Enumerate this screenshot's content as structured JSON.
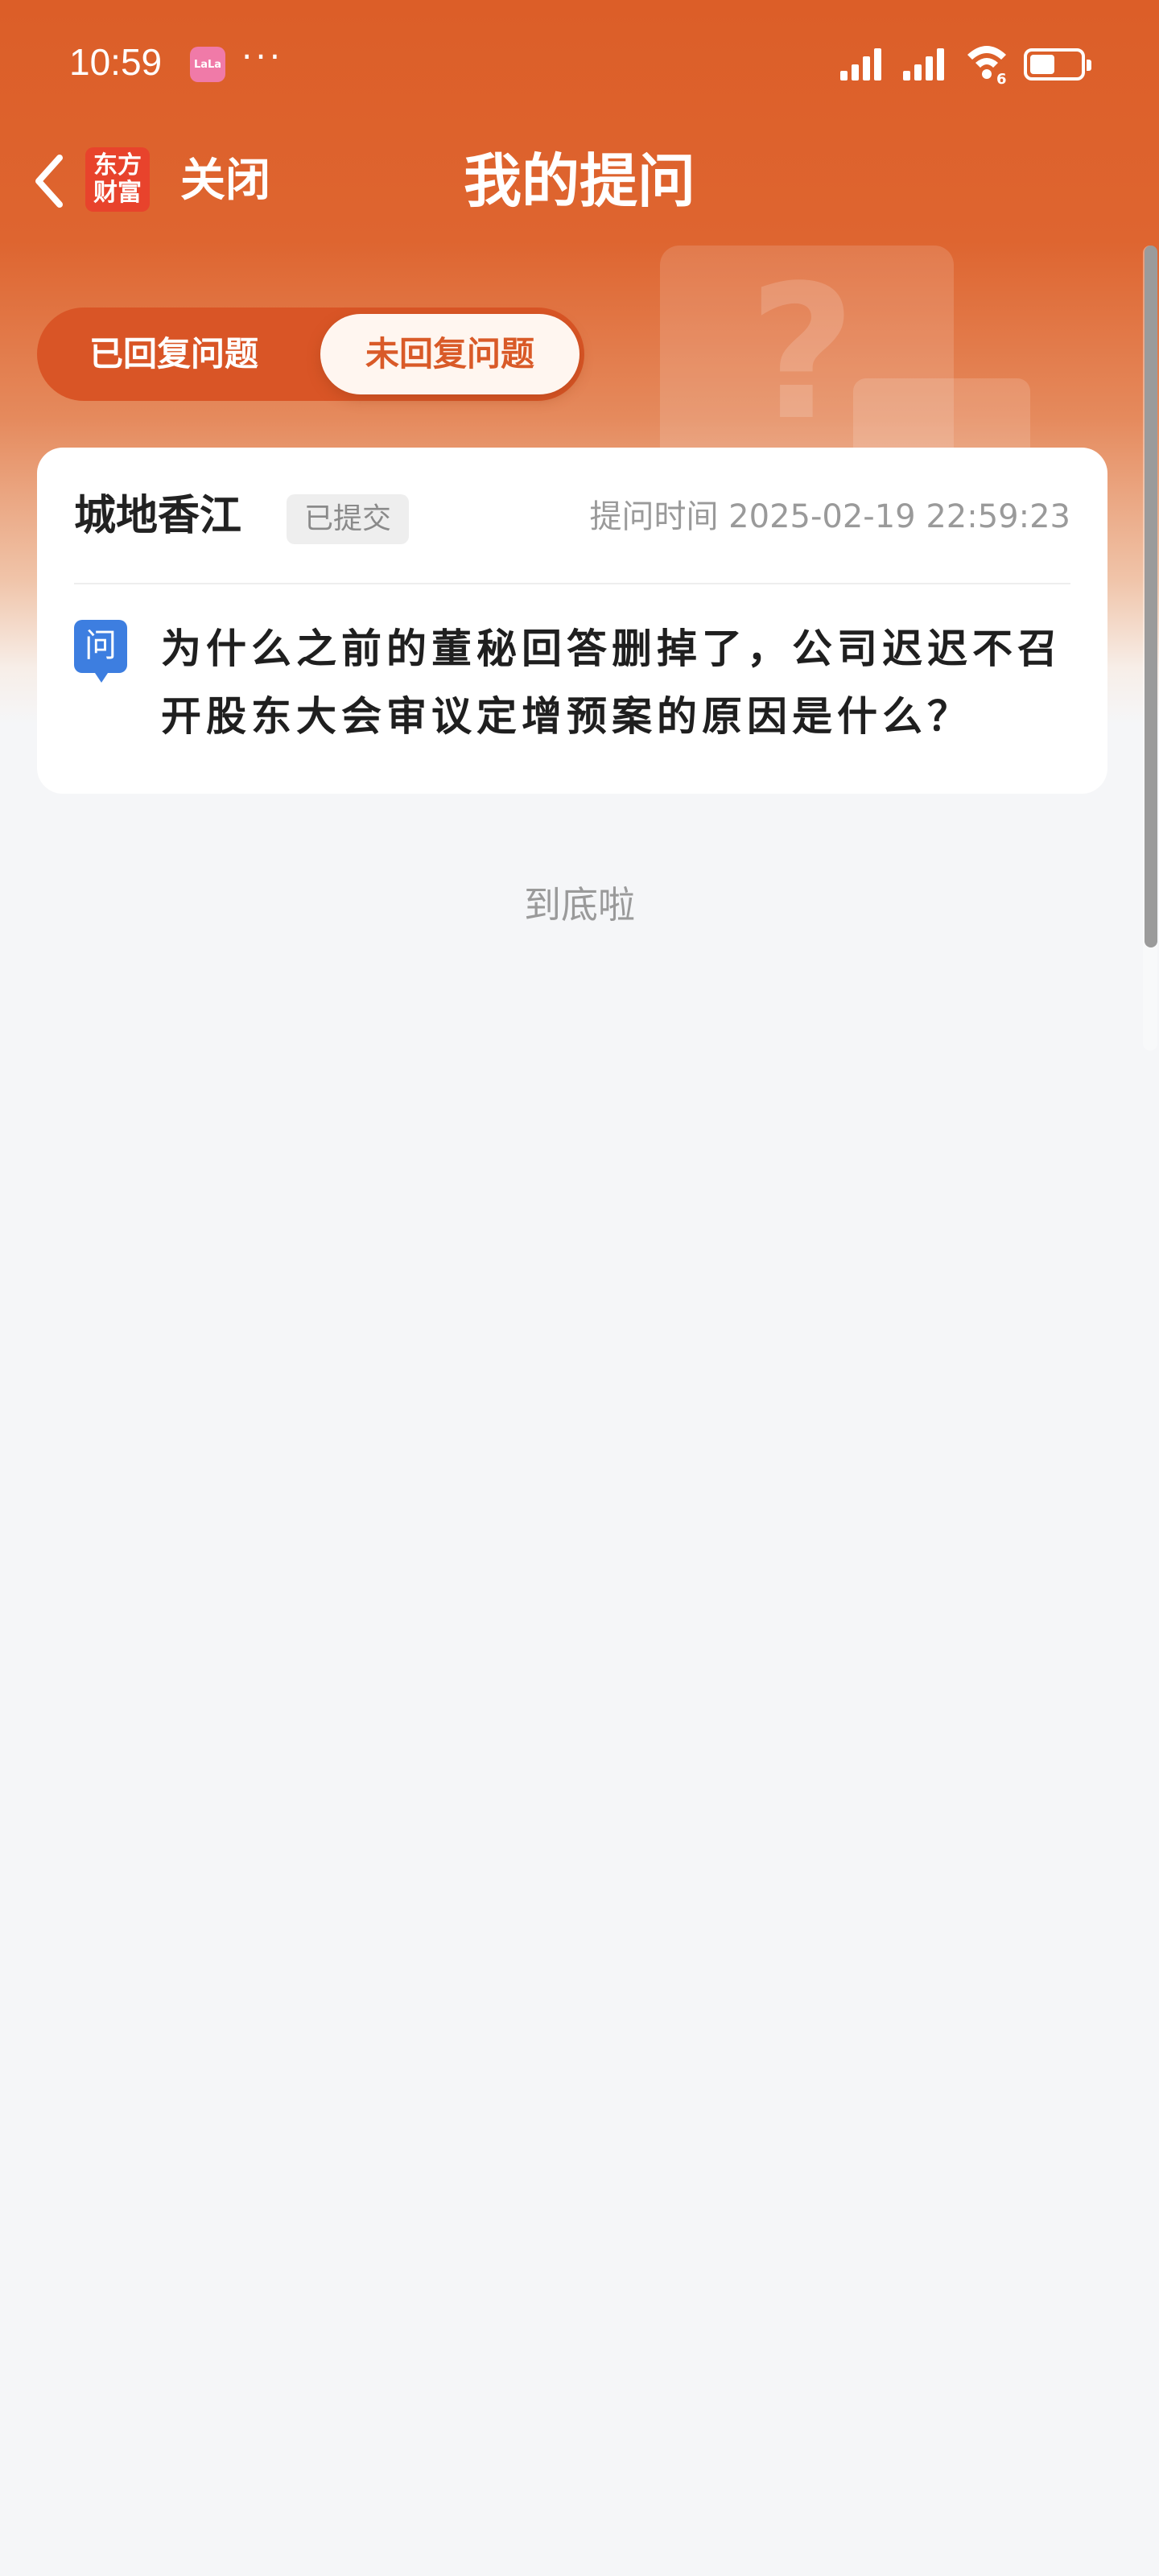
{
  "status_bar": {
    "time": "10:59",
    "app_icon_label": "LaLa",
    "more": "···",
    "wifi_sub": "6",
    "battery_level": 0.45
  },
  "nav": {
    "logo": "东方财富",
    "close_label": "关闭",
    "title": "我的提问"
  },
  "tabs": [
    {
      "label": "已回复问题",
      "active": false
    },
    {
      "label": "未回复问题",
      "active": true
    }
  ],
  "question": {
    "user": "城地香江",
    "status": "已提交",
    "time_label": "提问时间 2025-02-19 22:59:23",
    "icon_label": "问",
    "text": "为什么之前的董秘回答删掉了，公司迟迟不召开股东大会审议定增预案的原因是什么？"
  },
  "footer": {
    "end_text": "到底啦"
  },
  "colors": {
    "accent": "#dc5e28",
    "question_icon": "#3d7ee0"
  }
}
